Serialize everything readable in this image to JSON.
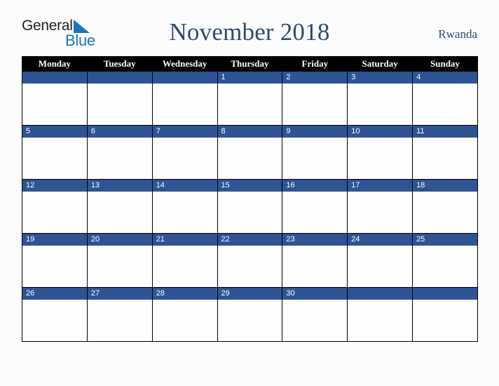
{
  "brand": {
    "name_part1": "General",
    "name_part2": "Blue",
    "triangle_icon": "triangle-icon"
  },
  "header": {
    "title": "November 2018",
    "country": "Rwanda"
  },
  "colors": {
    "page_background": "#fcfcfd",
    "title_navy": "#2e4a72",
    "date_bar_blue": "#2e5494",
    "weekday_header_background": "#000000",
    "weekday_header_text": "#ffffff",
    "cell_background": "#fdfdfe",
    "logo_dark": "#231f20",
    "logo_blue": "#1b75bb"
  },
  "calendar": {
    "month": "November",
    "year": "2018",
    "first_day_of_week": "Monday",
    "weekday_headers": [
      "Monday",
      "Tuesday",
      "Wednesday",
      "Thursday",
      "Friday",
      "Saturday",
      "Sunday"
    ],
    "weeks": [
      [
        "",
        "",
        "",
        "1",
        "2",
        "3",
        "4"
      ],
      [
        "5",
        "6",
        "7",
        "8",
        "9",
        "10",
        "11"
      ],
      [
        "12",
        "13",
        "14",
        "15",
        "16",
        "17",
        "18"
      ],
      [
        "19",
        "20",
        "21",
        "22",
        "23",
        "24",
        "25"
      ],
      [
        "26",
        "27",
        "28",
        "29",
        "30",
        "",
        ""
      ]
    ]
  }
}
